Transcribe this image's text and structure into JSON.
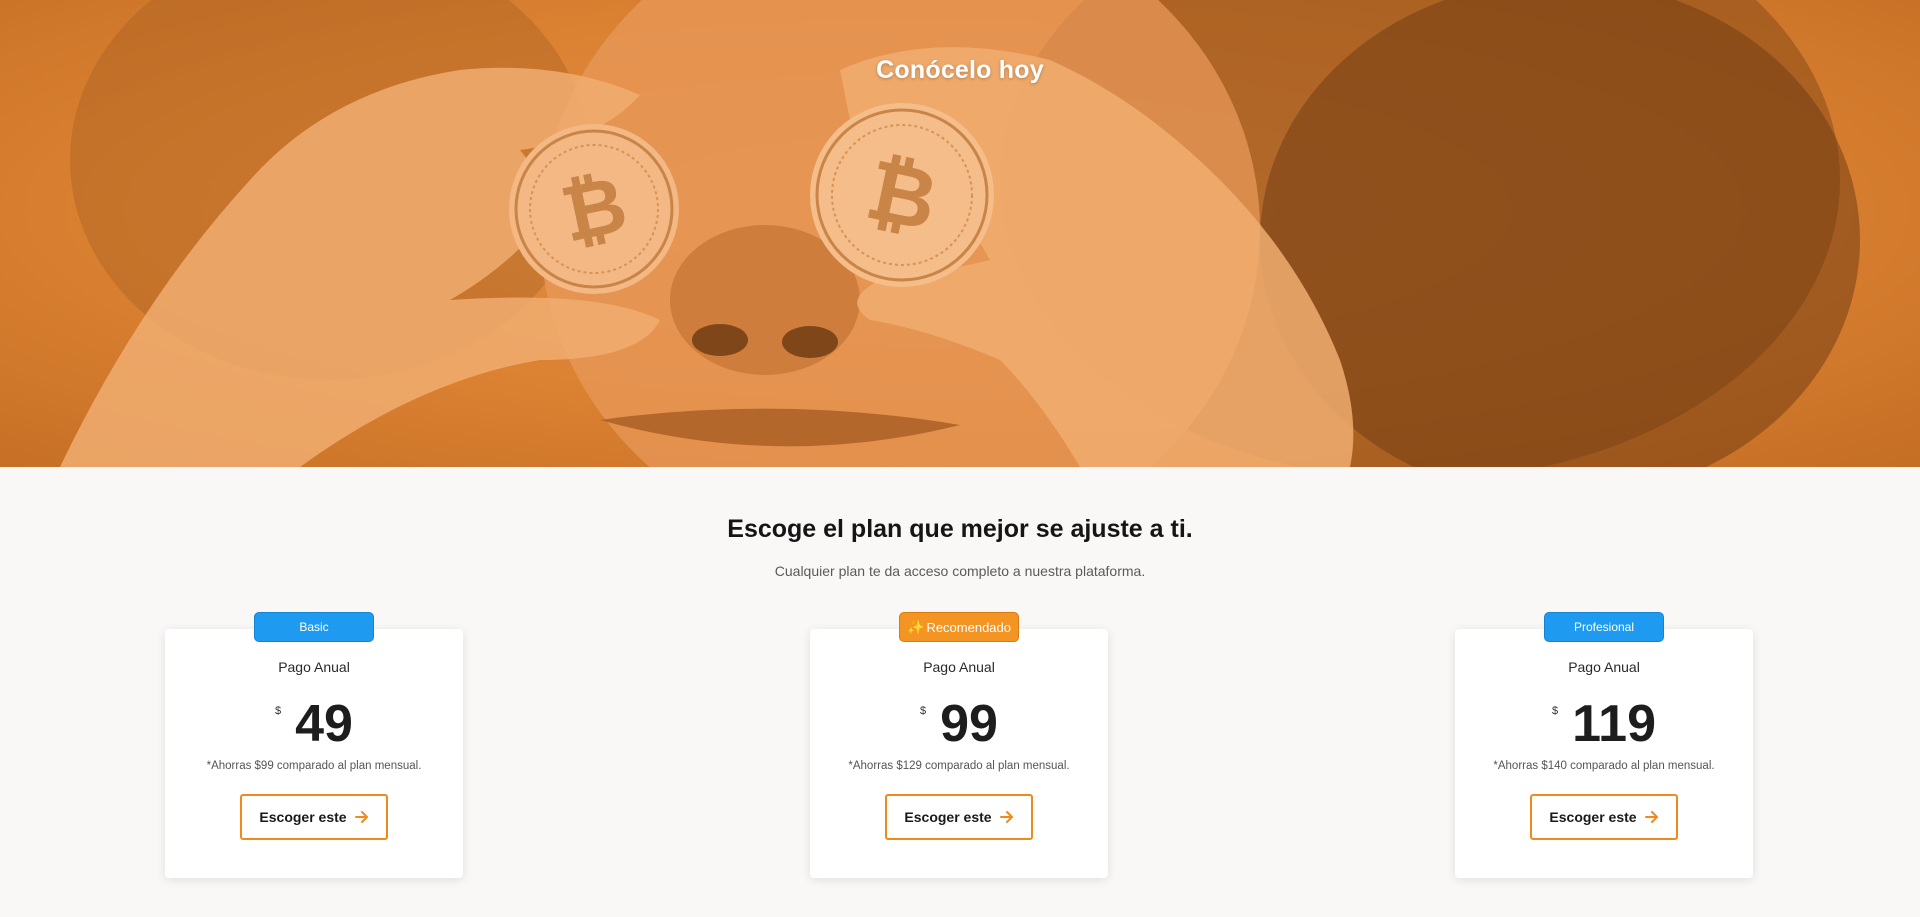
{
  "hero": {
    "title": "Conócelo hoy"
  },
  "plans_section": {
    "title": "Escoge el plan que mejor se ajuste a ti.",
    "subtitle": "Cualquier plan te da acceso completo a nuestra plataforma."
  },
  "plans": [
    {
      "badge": "Basic",
      "badge_color": "#1e9bf0",
      "label": "Pago Anual",
      "currency": "$",
      "amount": "49",
      "savings": "*Ahorras $99 comparado al plan mensual.",
      "button_label": "Escoger este"
    },
    {
      "badge": "Recomendado",
      "badge_color": "#f39423",
      "badge_icon": "sparkle-icon",
      "label": "Pago Anual",
      "currency": "$",
      "amount": "99",
      "savings": "*Ahorras $129 comparado al plan mensual.",
      "button_label": "Escoger este"
    },
    {
      "badge": "Profesional",
      "badge_color": "#1e9bf0",
      "label": "Pago Anual",
      "currency": "$",
      "amount": "119",
      "savings": "*Ahorras $140 comparado al plan mensual.",
      "button_label": "Escoger este"
    }
  ],
  "colors": {
    "accent": "#f08a1c",
    "hero_tint": "#db8132",
    "badge_blue": "#1e9bf0",
    "background": "#f9f8f6"
  }
}
